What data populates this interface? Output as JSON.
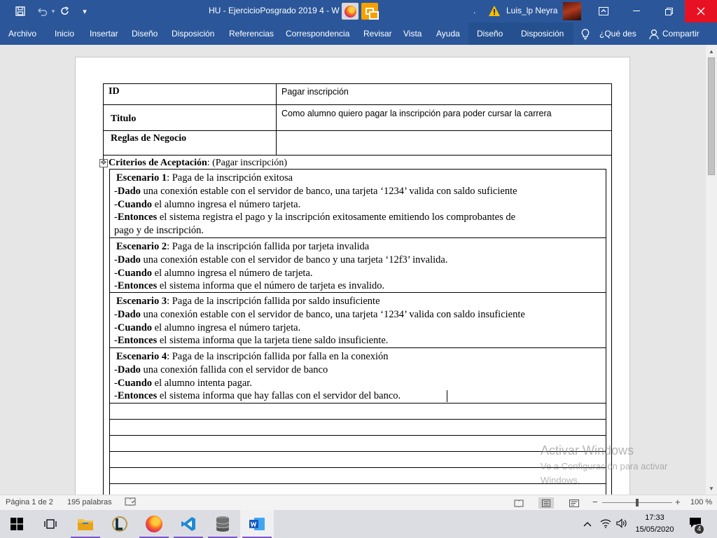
{
  "window": {
    "title": "HU - EjercicioPosgrado 2019 4  -  W",
    "separator": ".",
    "user_name": "Luis_lp Neyra",
    "controls": {
      "minimize": "—",
      "restore": "❐",
      "maximize": "▭",
      "close": "✕"
    }
  },
  "quick_access": {
    "save": "save-icon",
    "undo": "undo-icon",
    "redo": "redo-icon",
    "customize": "▾"
  },
  "ribbon": {
    "tabs": [
      "Archivo",
      "Inicio",
      "Insertar",
      "Diseño",
      "Disposición",
      "Referencias",
      "Correspondencia",
      "Revisar",
      "Vista",
      "Ayuda"
    ],
    "context_tabs": [
      "Diseño",
      "Disposición"
    ],
    "tell_me": "¿Qué des",
    "share": "Compartir"
  },
  "document": {
    "table": [
      {
        "label": "ID",
        "value": "Pagar inscripción"
      },
      {
        "label": "Titulo",
        "value": "Como alumno quiero pagar la inscripción para poder cursar la carrera"
      },
      {
        "label": "Reglas de Negocio",
        "value": ""
      }
    ],
    "criteria": {
      "label": "Criterios de Aceptación",
      "rest": ": (Pagar inscripción)"
    },
    "scenarios": [
      {
        "title": "Escenario 1",
        "subtitle": ": Paga de la inscripción exitosa",
        "lines": [
          {
            "kw": "Dado",
            "text": " una conexión estable con el servidor de banco, una tarjeta ‘1234’ valida con saldo suficiente"
          },
          {
            "kw": "Cuando",
            "text": " el alumno ingresa el número tarjeta."
          },
          {
            "kw": "Entonces",
            "text": " el sistema registra el pago y la inscripción exitosamente emitiendo los comprobantes de"
          },
          {
            "kw": "",
            "text": "pago y de inscripción."
          }
        ]
      },
      {
        "title": "Escenario 2",
        "subtitle": ": Paga de la inscripción fallida por tarjeta invalida",
        "lines": [
          {
            "kw": "Dado",
            "text": " una conexión estable con el servidor de banco y una tarjeta ‘12f3’ invalida."
          },
          {
            "kw": "Cuando",
            "text": " el alumno ingresa el número de tarjeta."
          },
          {
            "kw": "Entonces",
            "text": " el sistema informa que el número de tarjeta es invalido."
          }
        ]
      },
      {
        "title": "Escenario 3",
        "subtitle": ": Paga de la inscripción fallida por saldo insuficiente",
        "lines": [
          {
            "kw": "Dado",
            "text": " una conexión estable con el servidor de banco, una tarjeta ‘1234’ valida con saldo insuficiente"
          },
          {
            "kw": "Cuando",
            "text": " el alumno ingresa el número tarjeta."
          },
          {
            "kw": "Entonces",
            "text": " el sistema informa que la tarjeta tiene saldo insuficiente."
          }
        ]
      },
      {
        "title": "Escenario 4",
        "subtitle": ": Paga de la inscripción fallida por falla en la conexión",
        "lines": [
          {
            "kw": "Dado",
            "text": " una conexión fallida con el servidor de banco"
          },
          {
            "kw": "Cuando",
            "text": " el alumno intenta pagar."
          },
          {
            "kw": "Entonces",
            "text": " el sistema informa que hay fallas con el servidor del banco."
          }
        ]
      }
    ],
    "table_move_handle": "✥"
  },
  "watermark": {
    "title": "Activar Windows",
    "line1": "Ve a Configuración para activar",
    "line2": "Windows."
  },
  "status_bar": {
    "page": "Página 1 de 2",
    "words": "195 palabras",
    "zoom_minus": "−",
    "zoom_plus": "+",
    "zoom_level": "100 %"
  },
  "taskbar": {
    "apps": [
      "start-icon",
      "task-view-icon",
      "file-explorer-icon",
      "league-client-icon",
      "firefox-icon",
      "vscode-icon",
      "database-icon",
      "word-icon"
    ],
    "time": "17:33",
    "date": "15/05/2020",
    "notifications": "4"
  }
}
